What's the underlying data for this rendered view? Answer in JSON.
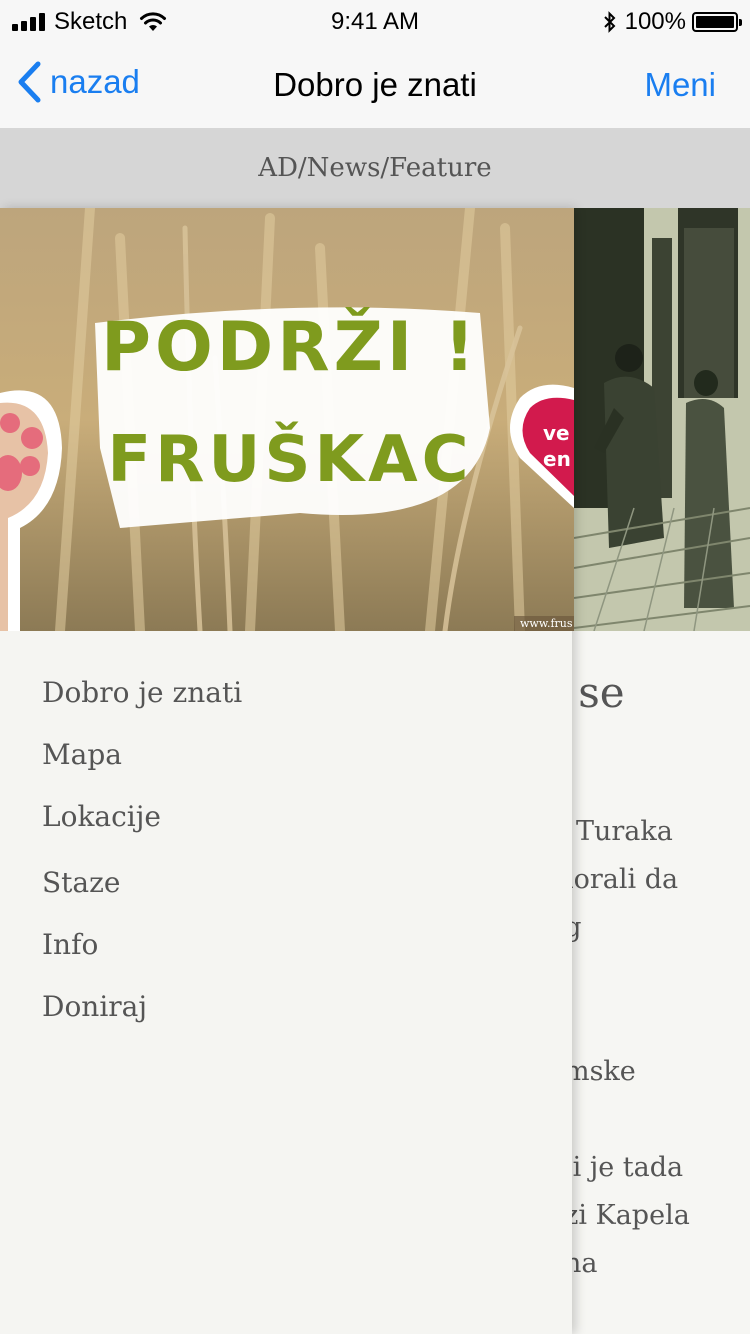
{
  "status_bar": {
    "carrier": "Sketch",
    "time": "9:41 AM",
    "battery": "100%"
  },
  "navbar": {
    "back_label": "nazad",
    "title": "Dobro je znati",
    "menu_label": "Meni"
  },
  "ad_banner": {
    "text": "AD/News/Feature"
  },
  "hero_image": {
    "headline_line1": "PODRŽI !",
    "headline_line2": "FRUŠKAC",
    "badge_text": "ve\nen",
    "watermark": "www.frus"
  },
  "drawer": {
    "items": [
      {
        "label": "Dobro je znati"
      },
      {
        "label": "Mapa"
      },
      {
        "label": "Lokacije"
      },
      {
        "label": "Staze"
      },
      {
        "label": "Info"
      },
      {
        "label": "Doniraj"
      }
    ]
  },
  "background_article": {
    "heading_fragment": "e se",
    "lines": [
      "Turaka",
      "morali da",
      "og",
      "emske",
      "oji je tada",
      "azi Kapela",
      "ena"
    ]
  },
  "colors": {
    "accent": "#1a7ef0",
    "ad_bg": "#d6d6d6",
    "drawer_bg": "#f5f5f2",
    "text_muted": "#555555",
    "logo_green": "#7f9b1e"
  }
}
